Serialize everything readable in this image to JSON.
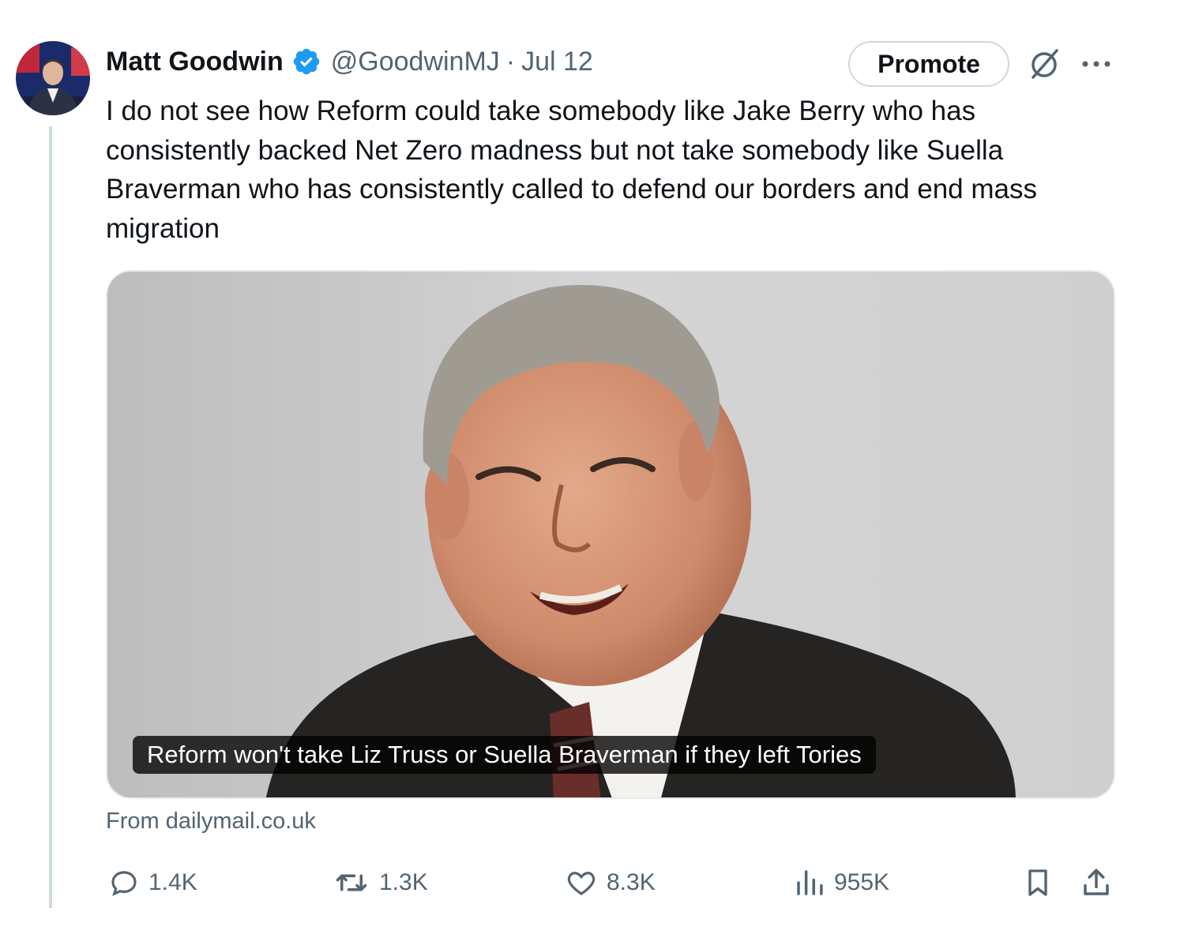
{
  "tweet": {
    "author_name": "Matt Goodwin",
    "handle": "@GoodwinMJ",
    "separator": "·",
    "date": "Jul 12",
    "verified": true,
    "promote_label": "Promote",
    "text": "I do not see how Reform could take somebody like Jake Berry who has consistently backed Net Zero madness but not take somebody like Suella Braverman who has consistently called to defend our borders and end mass migration",
    "card": {
      "title": "Reform won't take Liz Truss or Suella Braverman if they left Tories",
      "source": "From dailymail.co.uk"
    },
    "actions": {
      "replies": "1.4K",
      "reposts": "1.3K",
      "likes": "8.3K",
      "views": "955K"
    }
  },
  "colors": {
    "text_primary": "#0f1419",
    "text_secondary": "#536471",
    "verified_blue": "#1d9bf0",
    "border": "#cfd9de"
  },
  "icons": {
    "verified": "verified-badge-icon",
    "grok": "grok-icon",
    "more": "more-icon",
    "reply": "reply-icon",
    "repost": "repost-icon",
    "like": "like-icon",
    "views": "views-icon",
    "bookmark": "bookmark-icon",
    "share": "share-icon"
  }
}
